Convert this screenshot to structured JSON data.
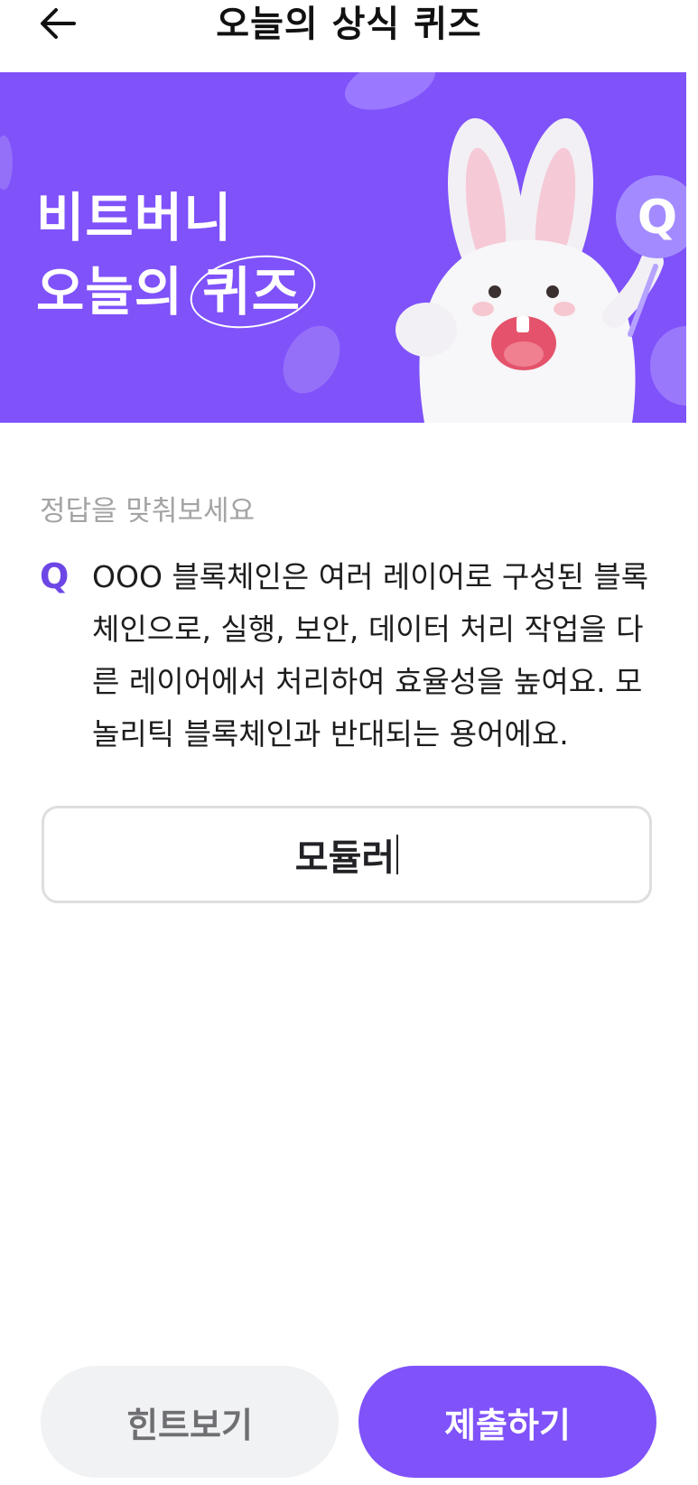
{
  "header": {
    "back_icon": "arrow-left-icon",
    "title": "오늘의 상식 퀴즈"
  },
  "banner": {
    "line1": "비트버니",
    "line2_prefix": "오늘의 ",
    "line2_circled": "퀴즈",
    "character": "bunny-mascot-holding-q-sign",
    "sign_letter": "Q",
    "background_color": "#7f52fa"
  },
  "quiz": {
    "prompt": "정답을 맞춰보세요",
    "q_label": "Q",
    "question": "OOO 블록체인은 여러 레이어로 구성된 블록체인으로, 실행, 보안, 데이터 처리 작업을 다른 레이어에서 처리하여 효율성을 높여요. 모놀리틱 블록체인과 반대되는 용어에요.",
    "answer_value": "모듈러"
  },
  "buttons": {
    "hint": "힌트보기",
    "submit": "제출하기"
  },
  "colors": {
    "accent": "#7f52fa",
    "q_label": "#6d47e6",
    "hint_bg": "#f1f2f4"
  }
}
